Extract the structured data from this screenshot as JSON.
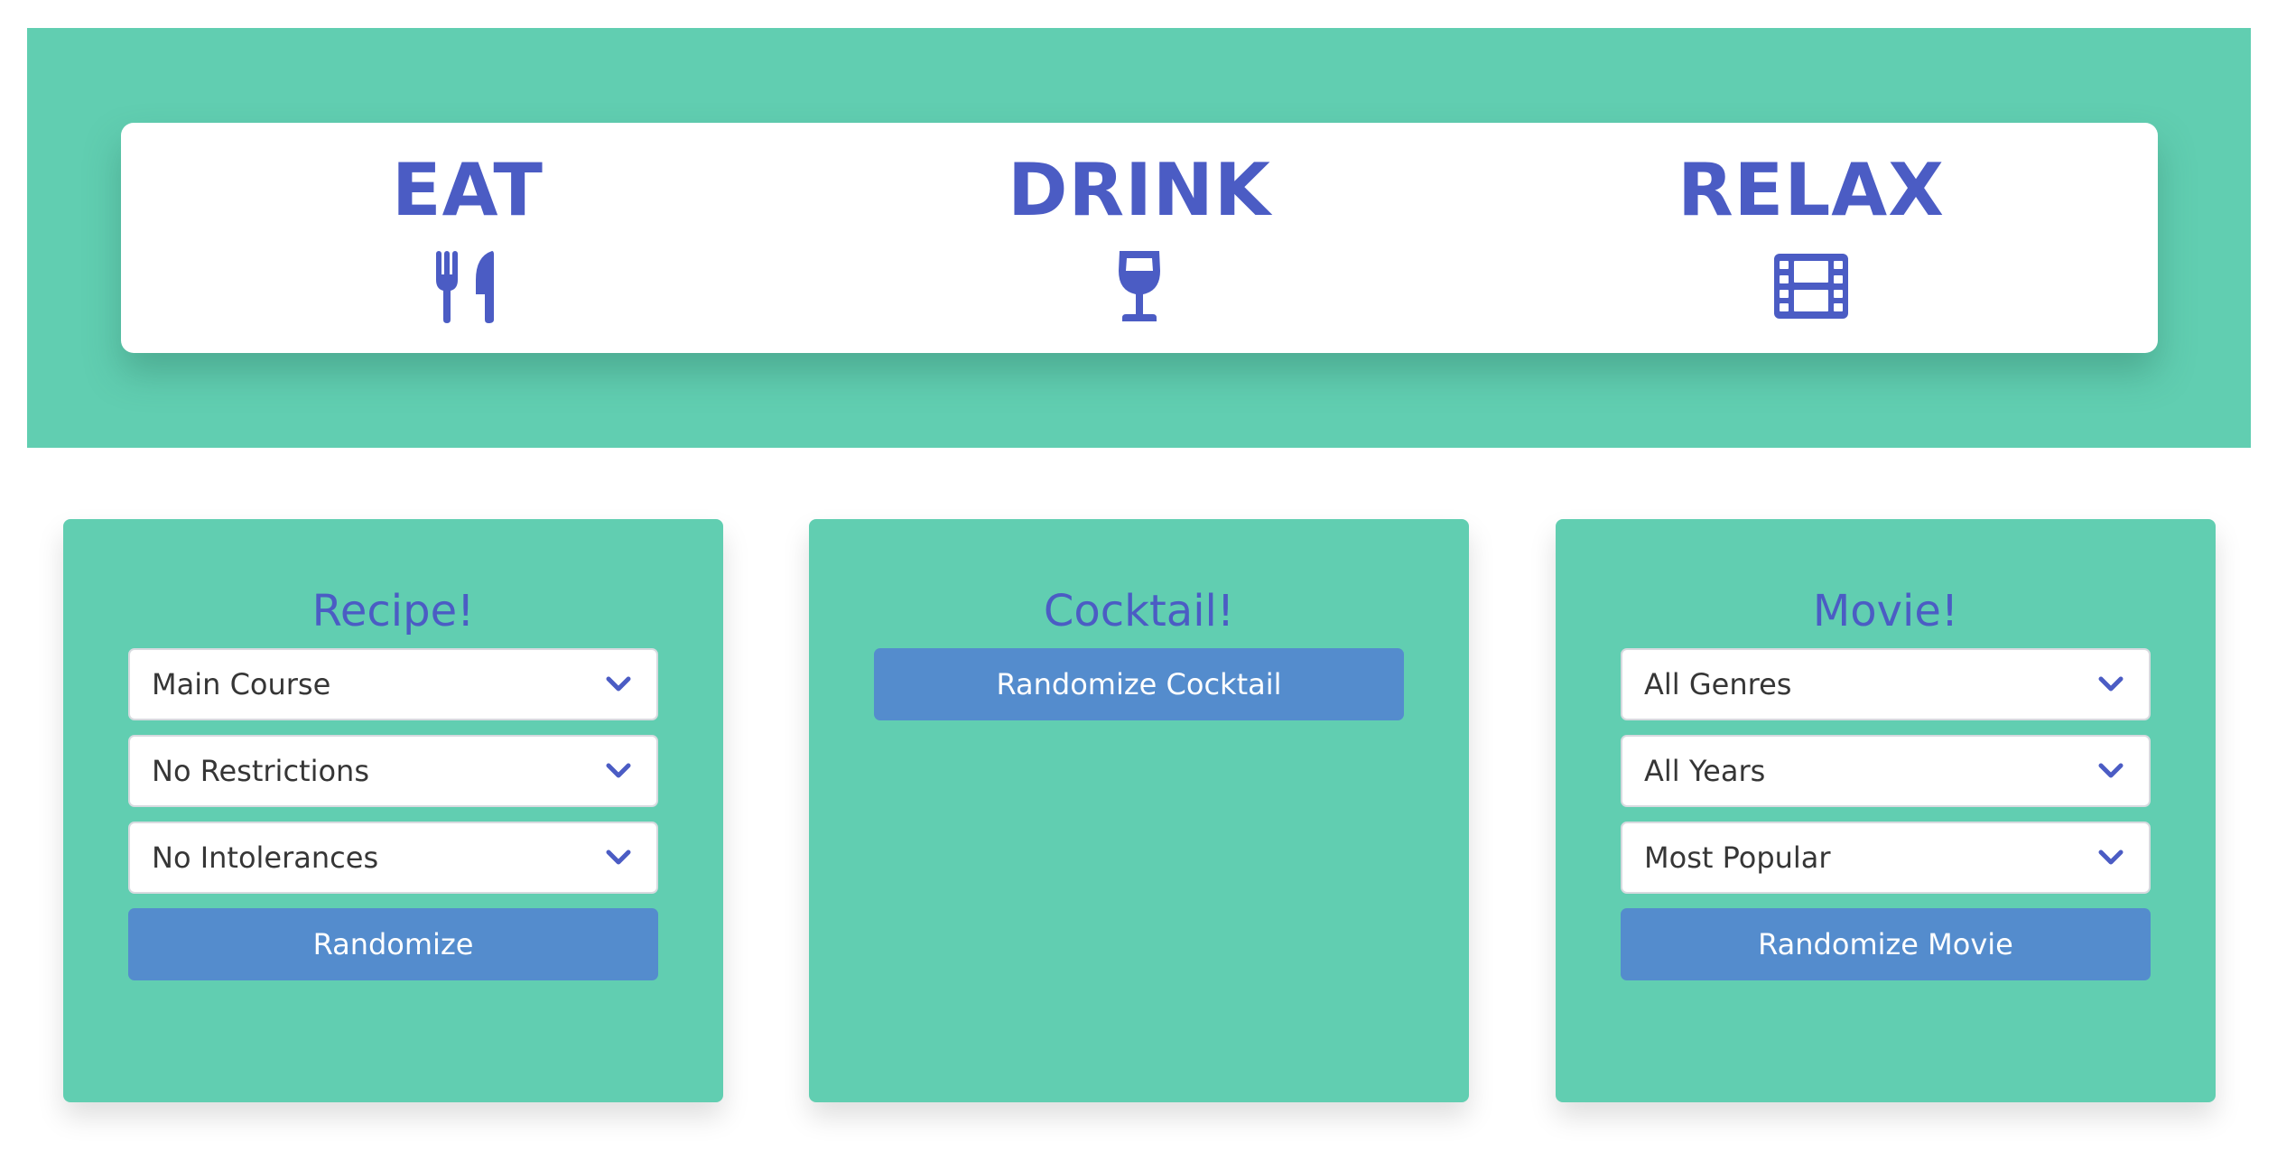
{
  "colors": {
    "teal": "#61ceb1",
    "indigo": "#4b5cc4",
    "button_blue": "#548ccd",
    "white": "#ffffff"
  },
  "hero": {
    "sections": [
      {
        "title": "EAT",
        "icon": "utensils-icon"
      },
      {
        "title": "DRINK",
        "icon": "wine-glass-icon"
      },
      {
        "title": "RELAX",
        "icon": "film-icon"
      }
    ]
  },
  "recipe": {
    "title": "Recipe!",
    "selects": [
      "Main Course",
      "No Restrictions",
      "No Intolerances"
    ],
    "button_label": "Randomize"
  },
  "cocktail": {
    "title": "Cocktail!",
    "button_label": "Randomize Cocktail"
  },
  "movie": {
    "title": "Movie!",
    "selects": [
      "All Genres",
      "All Years",
      "Most Popular"
    ],
    "button_label": "Randomize Movie"
  }
}
